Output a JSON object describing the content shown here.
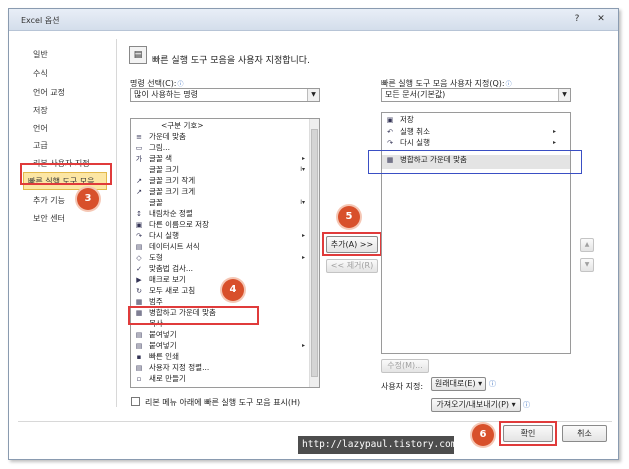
{
  "window": {
    "title": "Excel 옵션",
    "help_glyph": "?",
    "close_glyph": "✕"
  },
  "sidebar": {
    "items": [
      {
        "label": "일반"
      },
      {
        "label": "수식"
      },
      {
        "label": "언어 교정"
      },
      {
        "label": "저장"
      },
      {
        "label": "언어"
      },
      {
        "label": "고급"
      },
      {
        "label": "리본 사용자 지정"
      },
      {
        "label": "빠른 실행 도구 모음",
        "selected": true
      },
      {
        "label": "추가 기능"
      },
      {
        "label": "보안 센터"
      }
    ]
  },
  "header": {
    "title": "빠른 실행 도구 모음을 사용자 지정합니다."
  },
  "left": {
    "command_label": "명령 선택(C):",
    "command_value": "많이 사용하는 명령",
    "items": [
      {
        "icon": "",
        "label": "<구분 기호>",
        "separator": true
      },
      {
        "icon": "≡",
        "label": "가운데 맞춤"
      },
      {
        "icon": "▭",
        "label": "그림..."
      },
      {
        "icon": "가",
        "label": "글꼴 색",
        "sub": "▸"
      },
      {
        "icon": "",
        "label": "글꼴 크기",
        "sub": "I▾"
      },
      {
        "icon": "↗",
        "label": "글꼴 크기 작게"
      },
      {
        "icon": "↗",
        "label": "글꼴 크기 크게"
      },
      {
        "icon": "",
        "label": "글꼴",
        "sub": "I▾"
      },
      {
        "icon": "↕",
        "label": "내림차순 정렬"
      },
      {
        "icon": "▣",
        "label": "다른 이름으로 저장"
      },
      {
        "icon": "↷",
        "label": "다시 실행",
        "sub": "▸"
      },
      {
        "icon": "▤",
        "label": "데이터시트 서식"
      },
      {
        "icon": "◇",
        "label": "도형",
        "sub": "▸"
      },
      {
        "icon": "✓",
        "label": "맞춤법 검사..."
      },
      {
        "icon": "▶",
        "label": "매크로 보기"
      },
      {
        "icon": "↻",
        "label": "모두 새로 고침"
      },
      {
        "icon": "▦",
        "label": "범주"
      },
      {
        "icon": "▦",
        "label": "병합하고 가운데 맞춤"
      },
      {
        "icon": "",
        "label": "복사"
      },
      {
        "icon": "▤",
        "label": "붙여넣기"
      },
      {
        "icon": "▤",
        "label": "붙여넣기",
        "sub": "▸"
      },
      {
        "icon": "▪",
        "label": "빠른 인쇄"
      },
      {
        "icon": "▤",
        "label": "사용자 지정 정렬..."
      },
      {
        "icon": "▫",
        "label": "새로 만들기"
      }
    ]
  },
  "right": {
    "customize_label": "빠른 실행 도구 모음 사용자 지정(Q):",
    "customize_value": "모든 문서(기본값)",
    "items": [
      {
        "icon": "▣",
        "label": "저장"
      },
      {
        "icon": "↶",
        "label": "실행 취소",
        "sub": "▸"
      },
      {
        "icon": "↷",
        "label": "다시 실행",
        "sub": "▸"
      },
      {
        "icon": "▦",
        "label": "병합하고 가운데 맞춤",
        "highlighted": true
      }
    ],
    "modify_button": "수정(M)...",
    "user_def_label": "사용자 지정:",
    "reset_button": "원래대로(E) ▾",
    "import_export_button": "가져오기/내보내기(P) ▾"
  },
  "buttons": {
    "add": "추가(A) >>",
    "remove": "<< 제거(R)",
    "up_glyph": "▲",
    "down_glyph": "▼",
    "ok": "확인",
    "cancel": "취소"
  },
  "checkbox": {
    "label": "리본 메뉴 아래에 빠른 실행 도구 모음 표시(H)"
  },
  "badges": {
    "b3": "3",
    "b4": "4",
    "b5": "5",
    "b6": "6"
  },
  "watermark": "http://lazypaul.tistory.com"
}
